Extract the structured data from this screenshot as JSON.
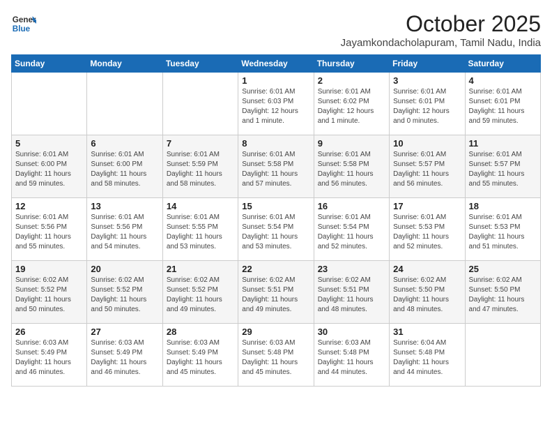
{
  "header": {
    "logo_line1": "General",
    "logo_line2": "Blue",
    "month": "October 2025",
    "location": "Jayamkondacholapuram, Tamil Nadu, India"
  },
  "weekdays": [
    "Sunday",
    "Monday",
    "Tuesday",
    "Wednesday",
    "Thursday",
    "Friday",
    "Saturday"
  ],
  "weeks": [
    [
      {
        "day": "",
        "info": ""
      },
      {
        "day": "",
        "info": ""
      },
      {
        "day": "",
        "info": ""
      },
      {
        "day": "1",
        "info": "Sunrise: 6:01 AM\nSunset: 6:03 PM\nDaylight: 12 hours\nand 1 minute."
      },
      {
        "day": "2",
        "info": "Sunrise: 6:01 AM\nSunset: 6:02 PM\nDaylight: 12 hours\nand 1 minute."
      },
      {
        "day": "3",
        "info": "Sunrise: 6:01 AM\nSunset: 6:01 PM\nDaylight: 12 hours\nand 0 minutes."
      },
      {
        "day": "4",
        "info": "Sunrise: 6:01 AM\nSunset: 6:01 PM\nDaylight: 11 hours\nand 59 minutes."
      }
    ],
    [
      {
        "day": "5",
        "info": "Sunrise: 6:01 AM\nSunset: 6:00 PM\nDaylight: 11 hours\nand 59 minutes."
      },
      {
        "day": "6",
        "info": "Sunrise: 6:01 AM\nSunset: 6:00 PM\nDaylight: 11 hours\nand 58 minutes."
      },
      {
        "day": "7",
        "info": "Sunrise: 6:01 AM\nSunset: 5:59 PM\nDaylight: 11 hours\nand 58 minutes."
      },
      {
        "day": "8",
        "info": "Sunrise: 6:01 AM\nSunset: 5:58 PM\nDaylight: 11 hours\nand 57 minutes."
      },
      {
        "day": "9",
        "info": "Sunrise: 6:01 AM\nSunset: 5:58 PM\nDaylight: 11 hours\nand 56 minutes."
      },
      {
        "day": "10",
        "info": "Sunrise: 6:01 AM\nSunset: 5:57 PM\nDaylight: 11 hours\nand 56 minutes."
      },
      {
        "day": "11",
        "info": "Sunrise: 6:01 AM\nSunset: 5:57 PM\nDaylight: 11 hours\nand 55 minutes."
      }
    ],
    [
      {
        "day": "12",
        "info": "Sunrise: 6:01 AM\nSunset: 5:56 PM\nDaylight: 11 hours\nand 55 minutes."
      },
      {
        "day": "13",
        "info": "Sunrise: 6:01 AM\nSunset: 5:56 PM\nDaylight: 11 hours\nand 54 minutes."
      },
      {
        "day": "14",
        "info": "Sunrise: 6:01 AM\nSunset: 5:55 PM\nDaylight: 11 hours\nand 53 minutes."
      },
      {
        "day": "15",
        "info": "Sunrise: 6:01 AM\nSunset: 5:54 PM\nDaylight: 11 hours\nand 53 minutes."
      },
      {
        "day": "16",
        "info": "Sunrise: 6:01 AM\nSunset: 5:54 PM\nDaylight: 11 hours\nand 52 minutes."
      },
      {
        "day": "17",
        "info": "Sunrise: 6:01 AM\nSunset: 5:53 PM\nDaylight: 11 hours\nand 52 minutes."
      },
      {
        "day": "18",
        "info": "Sunrise: 6:01 AM\nSunset: 5:53 PM\nDaylight: 11 hours\nand 51 minutes."
      }
    ],
    [
      {
        "day": "19",
        "info": "Sunrise: 6:02 AM\nSunset: 5:52 PM\nDaylight: 11 hours\nand 50 minutes."
      },
      {
        "day": "20",
        "info": "Sunrise: 6:02 AM\nSunset: 5:52 PM\nDaylight: 11 hours\nand 50 minutes."
      },
      {
        "day": "21",
        "info": "Sunrise: 6:02 AM\nSunset: 5:52 PM\nDaylight: 11 hours\nand 49 minutes."
      },
      {
        "day": "22",
        "info": "Sunrise: 6:02 AM\nSunset: 5:51 PM\nDaylight: 11 hours\nand 49 minutes."
      },
      {
        "day": "23",
        "info": "Sunrise: 6:02 AM\nSunset: 5:51 PM\nDaylight: 11 hours\nand 48 minutes."
      },
      {
        "day": "24",
        "info": "Sunrise: 6:02 AM\nSunset: 5:50 PM\nDaylight: 11 hours\nand 48 minutes."
      },
      {
        "day": "25",
        "info": "Sunrise: 6:02 AM\nSunset: 5:50 PM\nDaylight: 11 hours\nand 47 minutes."
      }
    ],
    [
      {
        "day": "26",
        "info": "Sunrise: 6:03 AM\nSunset: 5:49 PM\nDaylight: 11 hours\nand 46 minutes."
      },
      {
        "day": "27",
        "info": "Sunrise: 6:03 AM\nSunset: 5:49 PM\nDaylight: 11 hours\nand 46 minutes."
      },
      {
        "day": "28",
        "info": "Sunrise: 6:03 AM\nSunset: 5:49 PM\nDaylight: 11 hours\nand 45 minutes."
      },
      {
        "day": "29",
        "info": "Sunrise: 6:03 AM\nSunset: 5:48 PM\nDaylight: 11 hours\nand 45 minutes."
      },
      {
        "day": "30",
        "info": "Sunrise: 6:03 AM\nSunset: 5:48 PM\nDaylight: 11 hours\nand 44 minutes."
      },
      {
        "day": "31",
        "info": "Sunrise: 6:04 AM\nSunset: 5:48 PM\nDaylight: 11 hours\nand 44 minutes."
      },
      {
        "day": "",
        "info": ""
      }
    ]
  ]
}
